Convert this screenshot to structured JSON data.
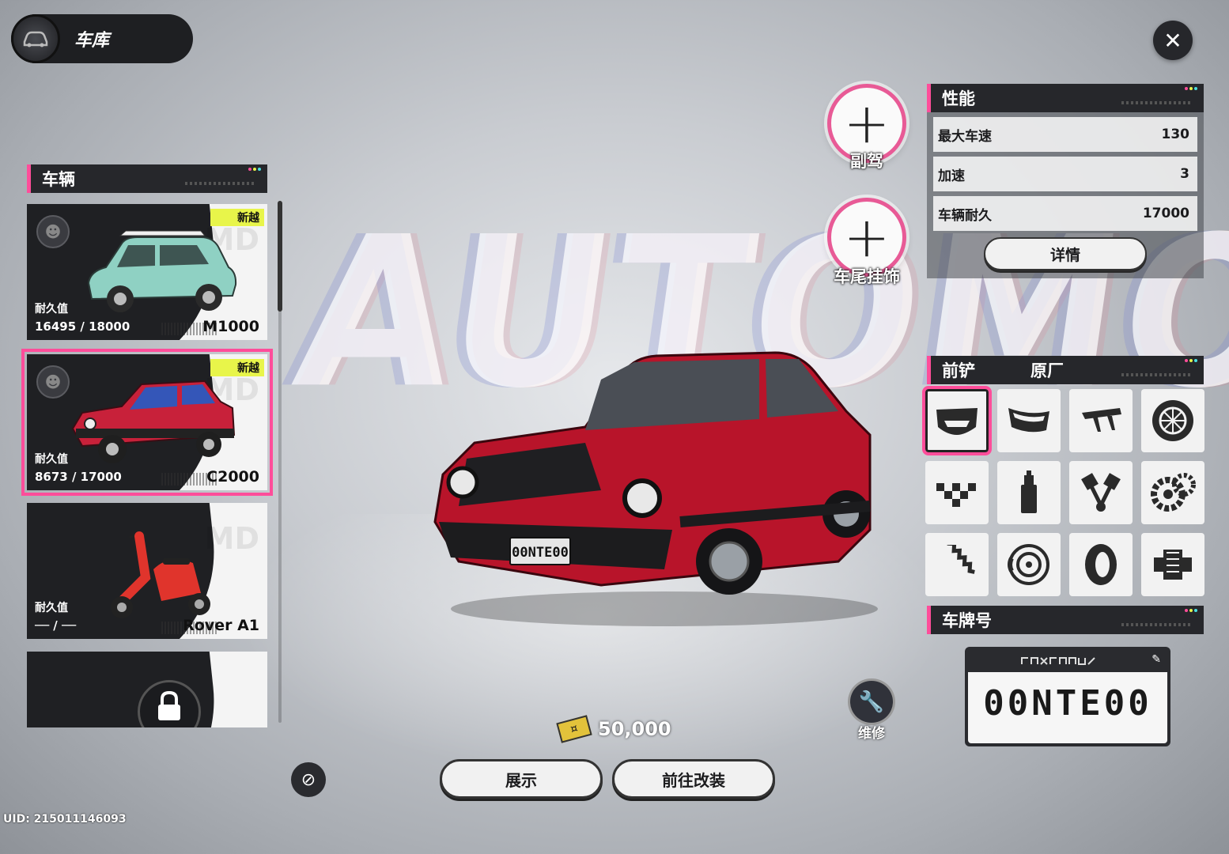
{
  "header": {
    "title": "车库"
  },
  "vehicles_section": {
    "title": "车辆"
  },
  "vehicles": [
    {
      "durability_label": "耐久值",
      "durability": "16495 / 18000",
      "model": "M1000",
      "tag": "新越",
      "body_color": "#8fd1c3",
      "locked": false
    },
    {
      "durability_label": "耐久值",
      "durability": "8673 / 17000",
      "model": "C2000",
      "tag": "新越",
      "body_color": "#c8213a",
      "locked": false,
      "selected": true
    },
    {
      "durability_label": "耐久值",
      "durability": "── / ──",
      "model": "Rover A1",
      "tag": "",
      "body_color": "#e0342c",
      "locked": false
    },
    {
      "durability_label": "",
      "durability": "",
      "model": "",
      "tag": "",
      "body_color": "#999999",
      "locked": true
    }
  ],
  "seat_buttons": [
    {
      "label": "副驾"
    },
    {
      "label": "车尾挂饰"
    }
  ],
  "performance": {
    "title": "性能",
    "rows": [
      {
        "label": "最大车速",
        "value": "130"
      },
      {
        "label": "加速",
        "value": "3"
      },
      {
        "label": "车辆耐久",
        "value": "17000"
      }
    ],
    "details_label": "详情"
  },
  "parts": {
    "title": "前铲",
    "current": "原厂",
    "items": [
      {
        "icon": "front-bumper-icon",
        "selected": true
      },
      {
        "icon": "rear-bumper-icon"
      },
      {
        "icon": "spoiler-icon"
      },
      {
        "icon": "rim-icon"
      },
      {
        "icon": "checker-flag-icon"
      },
      {
        "icon": "spray-paint-icon"
      },
      {
        "icon": "piston-icon"
      },
      {
        "icon": "gear-icon"
      },
      {
        "icon": "suspension-spring-icon"
      },
      {
        "icon": "brake-disc-icon"
      },
      {
        "icon": "tire-icon"
      },
      {
        "icon": "engine-icon"
      }
    ]
  },
  "plate": {
    "title": "车牌号",
    "number": "00NTE00"
  },
  "car_plate_text": "00NTE00",
  "currency": {
    "amount": "50,000"
  },
  "buttons": {
    "showcase": "展示",
    "modify": "前往改装",
    "repair": "维修"
  },
  "uid": "UID: 215011146093",
  "accent_color": "#ff4d9a"
}
